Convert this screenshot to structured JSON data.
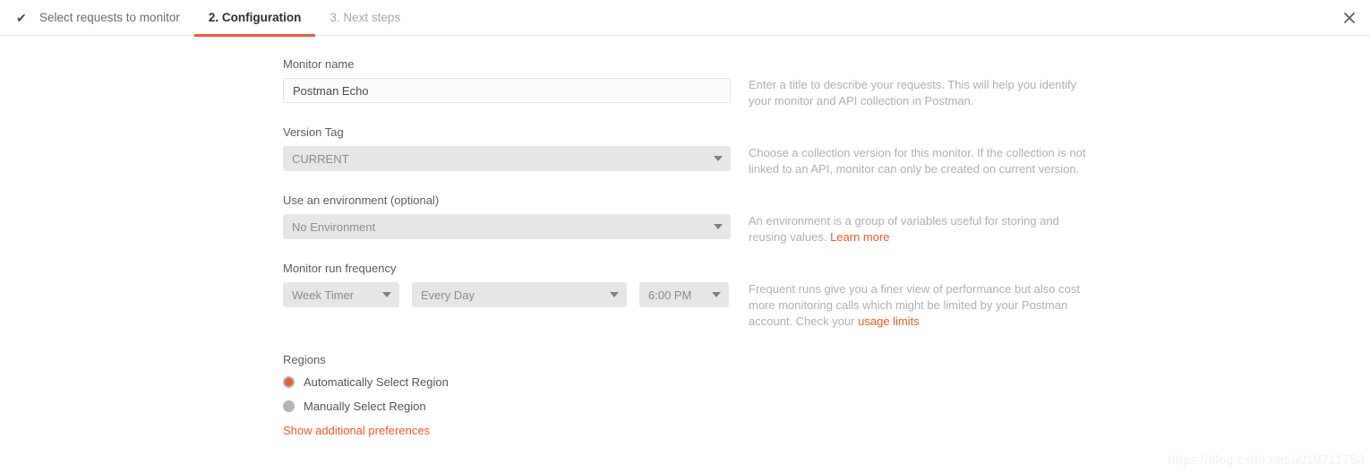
{
  "tabs": [
    {
      "label": "Select requests to monitor",
      "icon": "check-icon",
      "state": "completed"
    },
    {
      "label": "2. Configuration",
      "state": "active"
    },
    {
      "label": "3. Next steps",
      "state": "upcoming"
    }
  ],
  "close_label": "✕",
  "form": {
    "monitor_name": {
      "label": "Monitor name",
      "value": "Postman Echo",
      "placeholder": "Monitor name",
      "help": "Enter a title to describe your requests. This will help you identify your monitor and API collection in Postman."
    },
    "version_tag": {
      "label": "Version Tag",
      "value": "CURRENT",
      "help": "Choose a collection version for this monitor. If the collection is not linked to an API, monitor can only be created on current version."
    },
    "environment": {
      "label": "Use an environment (optional)",
      "value": "No Environment",
      "help_before": "An environment is a group of variables useful for storing and reusing values. ",
      "help_link": "Learn more"
    },
    "frequency": {
      "label": "Monitor run frequency",
      "timer_value": "Week Timer",
      "day_value": "Every Day",
      "time_value": "6:00 PM",
      "help_before": "Frequent runs give you a finer view of performance but also cost more monitoring calls which might be limited by your Postman account. Check your ",
      "help_link": "usage limits"
    },
    "regions": {
      "label": "Regions",
      "options": [
        {
          "label": "Automatically Select Region",
          "selected": true
        },
        {
          "label": "Manually Select Region",
          "selected": false
        }
      ],
      "show_preferences_label": "Show additional preferences"
    }
  },
  "watermark": "https://blog.csdn.net/u010711750",
  "colors": {
    "accent": "#f05a28",
    "label_text": "#5c5c5c",
    "help_text": "#b0b0b0",
    "select_bg": "#e6e6e6"
  }
}
